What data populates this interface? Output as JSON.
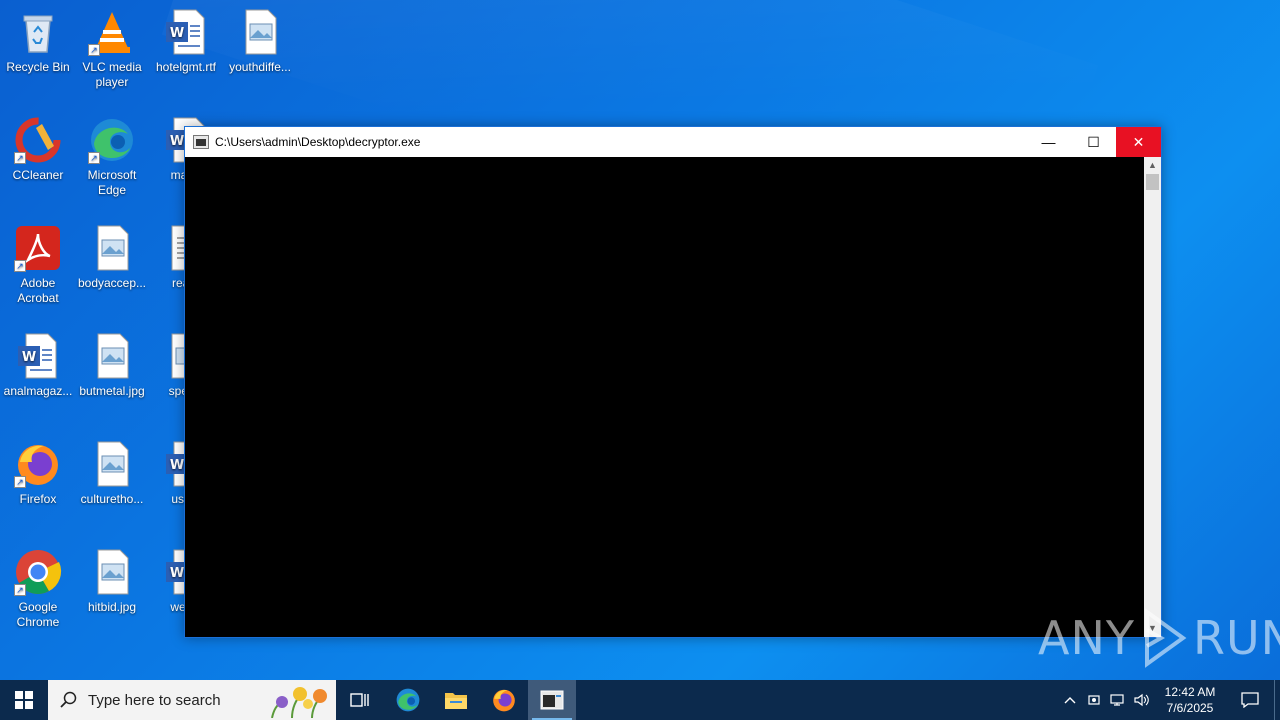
{
  "desktop": {
    "icons": [
      {
        "label": "Recycle Bin",
        "icon": "recycle-bin-icon"
      },
      {
        "label": "VLC media player",
        "icon": "vlc-icon"
      },
      {
        "label": "hotelgmt.rtf",
        "icon": "word-document-icon"
      },
      {
        "label": "youthdiffe...",
        "icon": "image-file-icon"
      },
      {
        "label": "CCleaner",
        "icon": "ccleaner-icon"
      },
      {
        "label": "Microsoft Edge",
        "icon": "edge-icon"
      },
      {
        "label": "mater",
        "icon": "word-document-icon"
      },
      {
        "label": "Adobe Acrobat",
        "icon": "acrobat-icon"
      },
      {
        "label": "bodyaccep...",
        "icon": "image-file-icon"
      },
      {
        "label": "readr",
        "icon": "text-file-icon"
      },
      {
        "label": "analmagaz...",
        "icon": "word-document-icon"
      },
      {
        "label": "butmetal.jpg",
        "icon": "image-file-icon"
      },
      {
        "label": "specie",
        "icon": "image-file-icon"
      },
      {
        "label": "Firefox",
        "icon": "firefox-icon"
      },
      {
        "label": "culturetho...",
        "icon": "image-file-icon"
      },
      {
        "label": "usbm",
        "icon": "word-document-icon"
      },
      {
        "label": "Google Chrome",
        "icon": "chrome-icon"
      },
      {
        "label": "hitbid.jpg",
        "icon": "image-file-icon"
      },
      {
        "label": "weddi",
        "icon": "word-document-icon"
      }
    ]
  },
  "window": {
    "title": "C:\\Users\\admin\\Desktop\\decryptor.exe",
    "minimize_glyph": "—",
    "maximize_glyph": "☐",
    "close_glyph": "✕"
  },
  "watermark": {
    "left": "ANY",
    "right": "RUN"
  },
  "taskbar": {
    "search_placeholder": "Type here to search",
    "time": "12:42 AM",
    "date": "7/6/2025"
  },
  "colors": {
    "accent": "#0b78e3",
    "close_red": "#e81123",
    "taskbar": "#0c2a4d"
  }
}
